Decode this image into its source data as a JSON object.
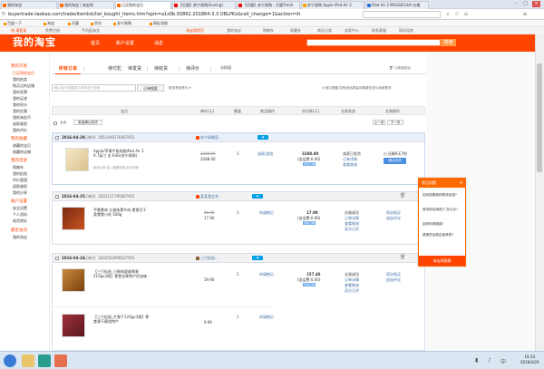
{
  "browser": {
    "tabs": [
      {
        "label": "我的淘宝",
        "active": false
      },
      {
        "label": "我的淘宝 | 淘宝网",
        "active": false
      },
      {
        "label": "已买到的宝贝",
        "active": true
      },
      {
        "label": "【天猫】苏宁易购(Suning)",
        "active": false
      },
      {
        "label": "【天猫】苏宁易购 - 天猫Tmall",
        "active": false
      },
      {
        "label": "苏宁易购 Apple iPad Air 2",
        "active": false
      },
      {
        "label": "iPad Air 2 MH182CH/A 价格",
        "active": false
      }
    ],
    "url": "buyertrade.taobao.com/trade/itemlist/list_bought_items.htm?spm=a1z0b.50862.201864-3.3.OBLPKx&cell_change=1&action=itl",
    "bookmarks": [
      "百度一下",
      "淘宝",
      "天猫",
      "京东",
      "苏宁易购",
      "网址导航"
    ]
  },
  "sitenav": {
    "left": [
      "亲,请登录",
      "免费注册",
      "手机逛淘宝"
    ],
    "right": [
      "淘宝网首页",
      "我的淘宝",
      "购物车",
      "收藏夹",
      "商品分类",
      "卖家中心",
      "联系客服",
      "网站导航"
    ]
  },
  "header": {
    "logo": "我的淘宝",
    "nav": [
      "首页",
      "账户设置",
      "消息"
    ],
    "search_placeholder": "",
    "search_btn": "搜索"
  },
  "sidebar": {
    "sections": [
      {
        "title": "我的交易",
        "items": [
          "已买到的宝贝",
          "我的拍卖",
          "购买过的店铺",
          "我的发票",
          "我的足迹",
          "我的积分",
          "我的优惠",
          "我的淘金币",
          "退款维权",
          "我的评价"
        ]
      },
      {
        "title": "我的收藏",
        "items": [
          "收藏的宝贝",
          "收藏的店铺"
        ]
      },
      {
        "title": "我的足迹",
        "items": [
          "购物车",
          "我的拍卖",
          "评价管理",
          "退款维权",
          "我的分享"
        ]
      },
      {
        "title": "账户设置",
        "items": [
          "安全设置",
          "个人资料",
          "收货地址"
        ]
      },
      {
        "title": "最近访问",
        "items": [
          "我的淘宝"
        ]
      }
    ]
  },
  "order_tabs": [
    {
      "label": "所有订单",
      "selected": true
    },
    {
      "label": "待付款",
      "selected": false
    },
    {
      "label": "待发货",
      "selected": false
    },
    {
      "label": "待收货",
      "selected": false
    },
    {
      "label": "待评价",
      "selected": false
    },
    {
      "label": "分阶段",
      "selected": false
    }
  ],
  "recycle_link": "订单回收站",
  "search": {
    "placeholder": "输入宝贝标题或订单号进行搜索",
    "btn": "订单搜索",
    "more": "更多筛选条件",
    "notice": "小宝贝提醒:如有商品质量问题请在线与卖家联系"
  },
  "table_headers": [
    "宝贝",
    "单价(元)",
    "数量",
    "商品操作",
    "实付款(元)",
    "交易状态",
    "交易操作"
  ],
  "toolbar": {
    "select_all": "全选",
    "batch_confirm": "批量确认收货",
    "prev": "上一页",
    "next": "下一页"
  },
  "orders": [
    {
      "date": "2016-04-29",
      "order_no_label": "订单号:",
      "order_no": "1851449176667951",
      "shop": "苏宁易购官...",
      "title": "Apple/苹果平板电脑iPad Air 2 9.7英寸 金 64G(苏宁易购)",
      "info": "颜色分类:金 | 套餐类型:官方标配",
      "orig_price": "3288.00",
      "price": "3288.00",
      "qty": "1",
      "ops": "退款/退货",
      "total": "3288.00",
      "shipping": "(含运费:0.00)",
      "pay_tag": "手机订单",
      "status": [
        "卖家已发货",
        "订单详情",
        "查看物流"
      ],
      "action": [
        "还剩9天7时",
        "确认收货"
      ]
    },
    {
      "date": "2016-04-25",
      "order_no_label": "订单号:",
      "order_no": "1835121795807951",
      "shop": "某某食品专...",
      "title": "手撕素肉 五香味素牛肉 素食豆干类零食小吃 500g",
      "info": "口味:五香",
      "orig_price": "26.90",
      "price": "17.90",
      "qty": "1",
      "ops": "申请售后",
      "total": "17.90",
      "shipping": "(含运费:0.00)",
      "pay_tag": "手机订单",
      "status": [
        "交易成功",
        "订单详情",
        "查看物流",
        "双方已评"
      ],
      "action": [
        "再次购买",
        "追加评论"
      ]
    },
    {
      "date": "2016-04-24",
      "order_no_label": "订单号:",
      "order_no": "1832562996637951",
      "shop": "三只松鼠...",
      "title": "【三只松鼠_小鲜肉夏威夷果210gx3袋】零食坚果特产奶油味",
      "info": "",
      "orig_price": "",
      "price": "19.90",
      "qty": "1",
      "ops": "申请售后",
      "total": "157.40",
      "shipping": "(含运费:0.00)",
      "pay_tag": "手机订单",
      "status": [
        "交易成功",
        "订单详情",
        "查看物流",
        "双方已评"
      ],
      "action": [
        "再次购买",
        "追加评论"
      ]
    },
    {
      "date": "",
      "order_no_label": "",
      "order_no": "",
      "shop": "",
      "title": "【三只松鼠_芒果干120gx3袋】零食果干蜜饯特产",
      "info": "",
      "orig_price": "",
      "price": "9.90",
      "qty": "1",
      "ops": "申请售后",
      "total": "",
      "shipping": "",
      "pay_tag": "",
      "status": [],
      "action": []
    }
  ],
  "help_panel": {
    "title": "常见问题",
    "questions": [
      "如何查看我的物流信息?",
      "收货地址填错了,怎么办?",
      "如何申请退款?",
      "退换货运费由谁承担?"
    ],
    "footer": "淘宝网客服"
  },
  "taskbar": {
    "time": "19:14",
    "date": "2016/4/29"
  },
  "colors": {
    "brand": "#ff4400",
    "link": "#3c6ea5",
    "button": "#4b8fe0"
  }
}
